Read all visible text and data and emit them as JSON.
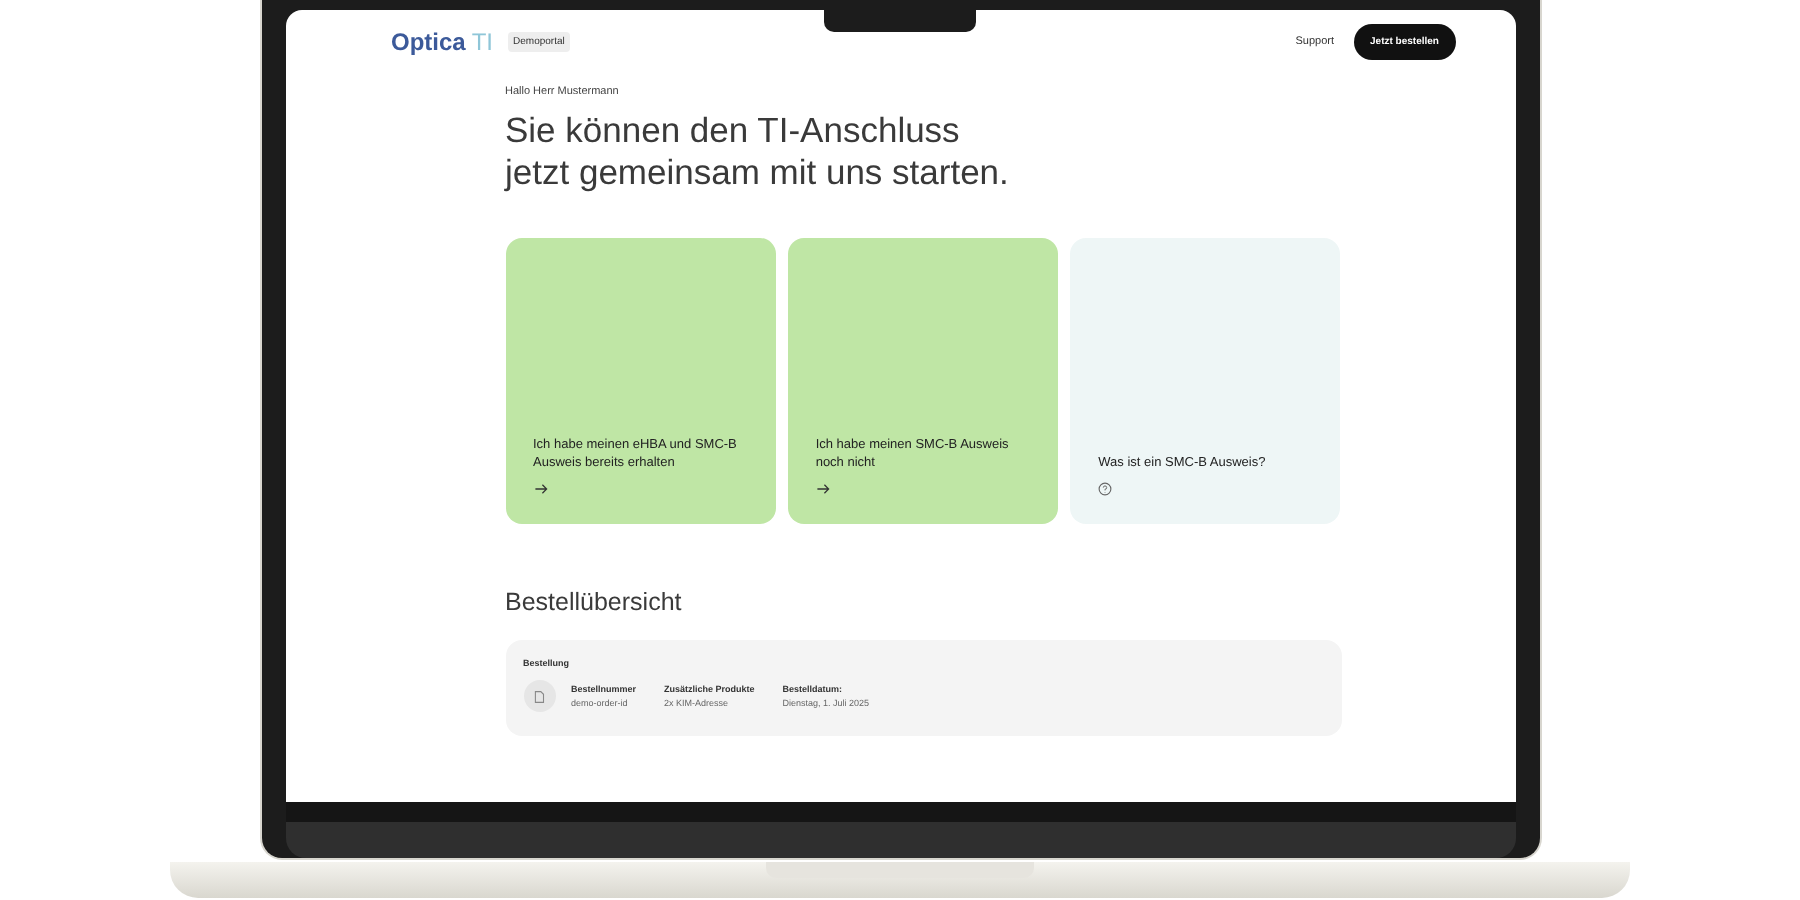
{
  "header": {
    "logo": {
      "name": "Optica",
      "accent": "TI"
    },
    "badge": "Demoportal",
    "links": [
      "Support"
    ],
    "cta": "Jetzt bestellen"
  },
  "greeting": "Hallo Herr Mustermann",
  "headline": [
    "Sie können den TI-Anschluss",
    "jetzt gemeinsam mit uns starten."
  ],
  "cards": [
    {
      "kind": "arrow",
      "text": "Ich habe meinen eHBA und SMC-B Ausweis bereits erhalten",
      "color": "#bfe6a5"
    },
    {
      "kind": "arrow",
      "text": "Ich habe meinen SMC-B Ausweis noch nicht",
      "color": "#bfe6a5"
    },
    {
      "kind": "info",
      "text": "Was ist ein SMC-B Ausweis?",
      "color": "#eef6f6"
    }
  ],
  "orders": {
    "title": "Bestellübersicht",
    "card_title": "Bestellung",
    "fields": [
      {
        "label": "Bestellnummer",
        "value": "demo-order-id"
      },
      {
        "label": "Zusätzliche Produkte",
        "value": "2x KIM-Adresse"
      },
      {
        "label": "Bestelldatum:",
        "value": "Dienstag, 1. Juli 2025"
      }
    ]
  }
}
